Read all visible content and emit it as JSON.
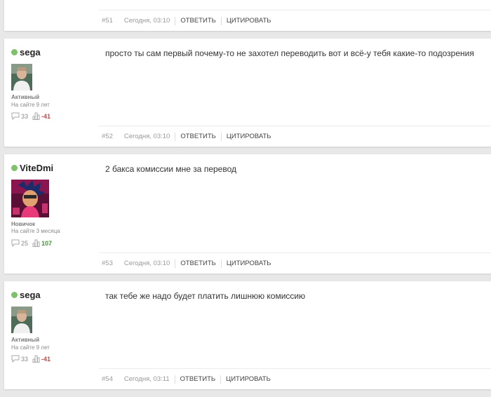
{
  "prev_post": {
    "number": "#51",
    "date": "Сегодня, 03:10",
    "reply_label": "ОТВЕТИТЬ",
    "quote_label": "ЦИТИРОВАТЬ"
  },
  "posts": [
    {
      "author": "sega",
      "status": "Активный",
      "on_site": "На сайте 9 лет",
      "comments_count": "33",
      "reputation": "-41",
      "message": "просто ты сам первый почему-то не захотел переводить вот и всё-у тебя какие-то подозрения",
      "number": "#52",
      "date": "Сегодня, 03:10",
      "reply_label": "ОТВЕТИТЬ",
      "quote_label": "ЦИТИРОВАТЬ"
    },
    {
      "author": "ViteDmi",
      "status": "Новичок",
      "on_site": "На сайте 3 месяца",
      "comments_count": "25",
      "reputation": "107",
      "message": "2 бакса комиссии мне за перевод",
      "number": "#53",
      "date": "Сегодня, 03:10",
      "reply_label": "ОТВЕТИТЬ",
      "quote_label": "ЦИТИРОВАТЬ"
    },
    {
      "author": "sega",
      "status": "Активный",
      "on_site": "На сайте 9 лет",
      "comments_count": "33",
      "reputation": "-41",
      "message": "так тебе же надо будет платить лишнюю комиссию",
      "number": "#54",
      "date": "Сегодня, 03:11",
      "reply_label": "ОТВЕТИТЬ",
      "quote_label": "ЦИТИРОВАТЬ"
    }
  ],
  "colors": {
    "online": "#7dc26a",
    "reputation_negative": "#d0413f",
    "reputation_positive": "#3e9a2e"
  }
}
